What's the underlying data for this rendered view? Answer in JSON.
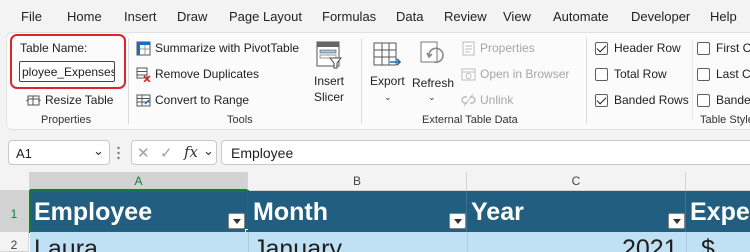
{
  "menu": [
    "File",
    "Home",
    "Insert",
    "Draw",
    "Page Layout",
    "Formulas",
    "Data",
    "Review",
    "View",
    "Automate",
    "Developer",
    "Help"
  ],
  "properties": {
    "table_name_label": "Table Name:",
    "table_name_value": "ployee_Expenses",
    "resize_table": "Resize Table",
    "group_label": "Properties"
  },
  "tools": {
    "summarize": "Summarize with PivotTable",
    "remove_duplicates": "Remove Duplicates",
    "convert_to_range": "Convert to Range",
    "insert_slicer_line1": "Insert",
    "insert_slicer_line2": "Slicer",
    "group_label": "Tools"
  },
  "external": {
    "export": "Export",
    "refresh": "Refresh",
    "properties": "Properties",
    "open_in_browser": "Open in Browser",
    "unlink": "Unlink",
    "group_label": "External Table Data"
  },
  "style_options": {
    "header_row": "Header Row",
    "total_row": "Total Row",
    "banded_rows": "Banded Rows",
    "first_column": "First Co",
    "last_column": "Last Co",
    "banded_columns": "Bande",
    "group_label": "Table Style",
    "header_row_checked": true,
    "total_row_checked": false,
    "banded_rows_checked": true,
    "first_column_checked": false,
    "last_column_checked": false,
    "banded_columns_checked": false
  },
  "formula_bar": {
    "name_box": "A1",
    "fx": "fx",
    "formula": "Employee"
  },
  "sheet": {
    "columns": [
      "A",
      "B",
      "C"
    ],
    "rows": [
      "1",
      "2"
    ],
    "headers": [
      "Employee",
      "Month",
      "Year",
      "Expe"
    ],
    "row2": [
      "Laura",
      "January",
      "2021",
      "$"
    ]
  },
  "colors": {
    "header_fill": "#215e7f",
    "band_fill": "#c0e0f3",
    "highlight": "#d9262c"
  }
}
